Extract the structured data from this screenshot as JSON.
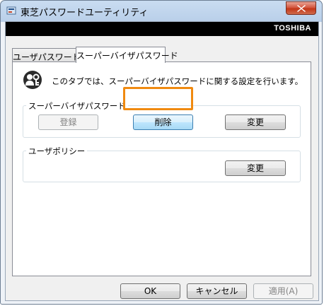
{
  "window": {
    "title": "東芝パスワードユーティリティ"
  },
  "brand": "TOSHIBA",
  "tabs": [
    {
      "label": "ユーザパスワード",
      "active": false
    },
    {
      "label": "スーパーバイザパスワード",
      "active": true
    }
  ],
  "panel": {
    "description": "このタブでは、スーパーバイザパスワードに関する設定を行います。",
    "supervisor_group": {
      "label": "スーパーバイザパスワード",
      "register_label": "登録",
      "delete_label": "削除",
      "change_label": "変更"
    },
    "policy_group": {
      "label": "ユーザポリシー",
      "change_label": "変更"
    }
  },
  "footer": {
    "ok_label": "OK",
    "cancel_label": "キャンセル",
    "apply_label": "適用(A)"
  },
  "colors": {
    "highlight": "#f08a10",
    "close_button": "#c23617"
  },
  "icons": [
    "app-icon",
    "close-icon",
    "key-user-icon"
  ]
}
